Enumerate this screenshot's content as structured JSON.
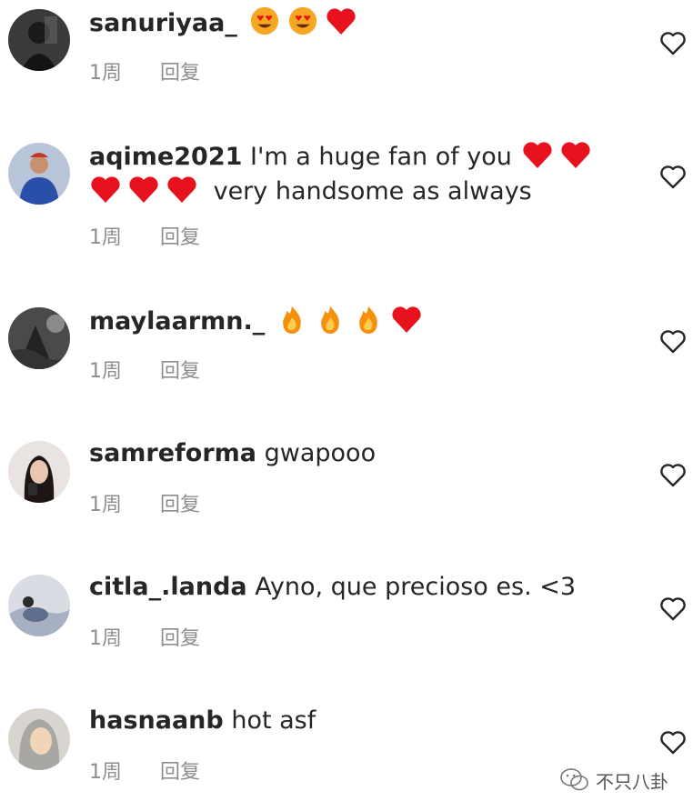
{
  "reply_label": "回复",
  "comments": [
    {
      "username": "sanuriyaa_",
      "text": "",
      "text_after_emoji": "",
      "emojis_inline": [
        "heart-eyes",
        "heart-eyes",
        "red-heart"
      ],
      "emojis_line2": [],
      "time": "1周"
    },
    {
      "username": "aqime2021",
      "text": "I'm a huge fan of you",
      "emojis_inline": [
        "red-heart",
        "red-heart"
      ],
      "emojis_line2": [
        "red-heart",
        "red-heart",
        "red-heart"
      ],
      "text_after_emoji": "very handsome as always",
      "time": "1周"
    },
    {
      "username": "maylaarmn._",
      "text": "",
      "text_after_emoji": "",
      "emojis_inline": [
        "fire",
        "fire",
        "fire",
        "red-heart"
      ],
      "emojis_line2": [],
      "time": "1周"
    },
    {
      "username": "samreforma",
      "text": "gwapooo",
      "text_after_emoji": "",
      "emojis_inline": [],
      "emojis_line2": [],
      "time": "1周"
    },
    {
      "username": "citla_.landa",
      "text": "Ayno, que precioso es. <3",
      "text_after_emoji": "",
      "emojis_inline": [],
      "emojis_line2": [],
      "time": "1周"
    },
    {
      "username": "hasnaanb",
      "text": "hot asf",
      "text_after_emoji": "",
      "emojis_inline": [],
      "emojis_line2": [],
      "time": "1周"
    }
  ],
  "watermark": {
    "text": "不只八卦",
    "icon": "wechat-logo-icon"
  },
  "colors": {
    "text": "#262626",
    "meta": "#8e8e8e",
    "heart_emoji": "#e8121e"
  }
}
